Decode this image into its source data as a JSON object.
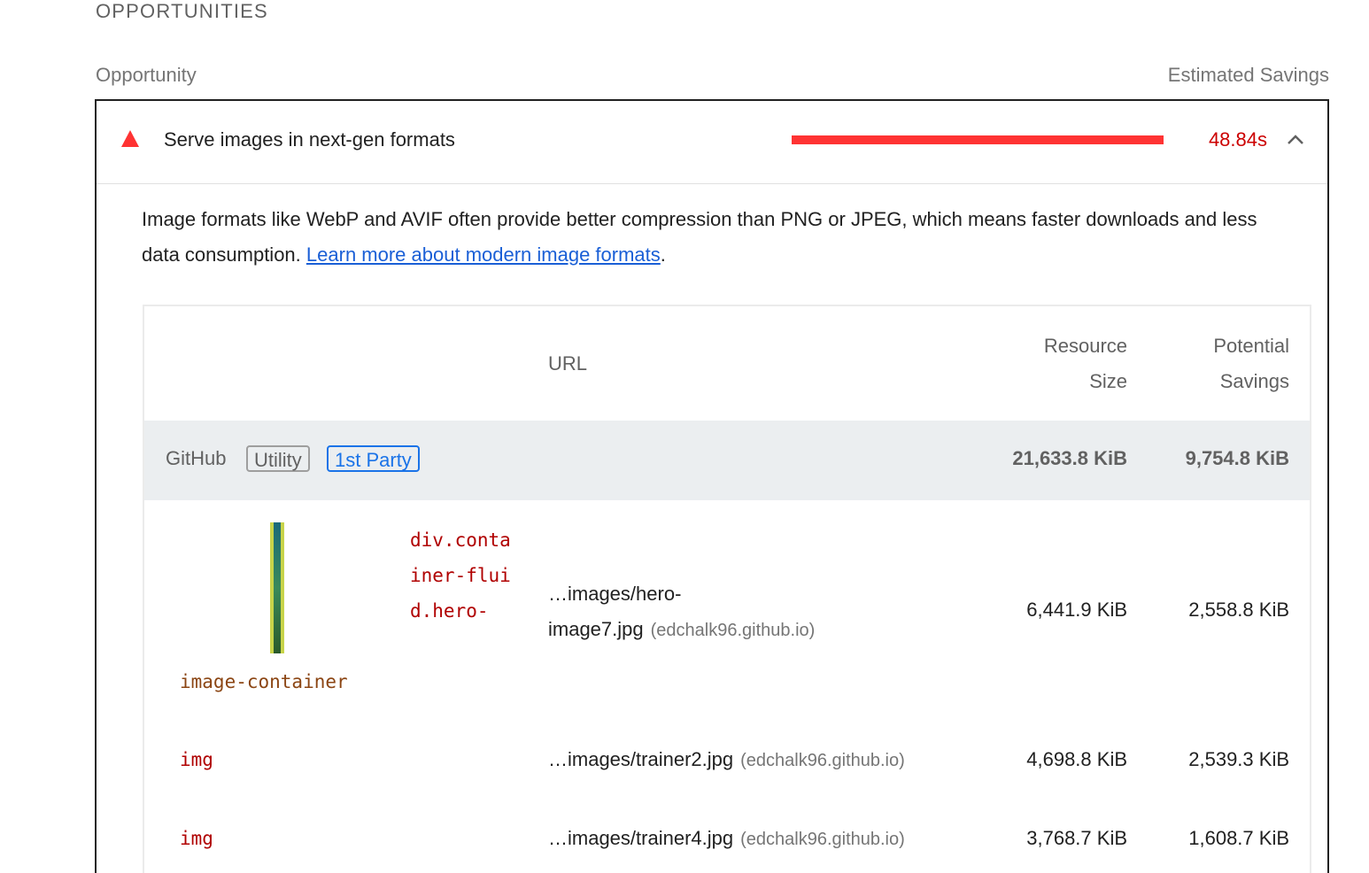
{
  "section": {
    "title": "OPPORTUNITIES",
    "col_left": "Opportunity",
    "col_right": "Estimated Savings"
  },
  "audit": {
    "title": "Serve images in next-gen formats",
    "savings": "48.84s",
    "savings_fraction": 1.0,
    "status_color": "#ff3333",
    "status_icon": "warning-triangle-icon",
    "toggle_icon": "chevron-up-icon",
    "description": "Image formats like WebP and AVIF often provide better compression than PNG or JPEG, which means faster downloads and less data consumption. ",
    "link_text": "Learn more about modern image formats",
    "period": "."
  },
  "table": {
    "headers": {
      "url": "URL",
      "size_line1": "Resource",
      "size_line2": "Size",
      "save_line1": "Potential",
      "save_line2": "Savings"
    },
    "group": {
      "entity": "GitHub",
      "tag_utility": "Utility",
      "tag_party": "1st Party",
      "size": "21,633.8 KiB",
      "savings": "9,754.8 KiB"
    },
    "rows": [
      {
        "node_selector": "div.container-fluid.hero-",
        "node_tail": "image-container",
        "url_line1": "…images/hero-",
        "url_line2": "image7.jpg",
        "host": "(edchalk96.github.io)",
        "size": "6,441.9 KiB",
        "savings": "2,558.8 KiB"
      },
      {
        "node": "img",
        "url": "…images/trainer2.jpg",
        "host": "(edchalk96.github.io)",
        "size": "4,698.8 KiB",
        "savings": "2,539.3 KiB"
      },
      {
        "node": "img",
        "url": "…images/trainer4.jpg",
        "host": "(edchalk96.github.io)",
        "size": "3,768.7 KiB",
        "savings": "1,608.7 KiB"
      }
    ]
  }
}
